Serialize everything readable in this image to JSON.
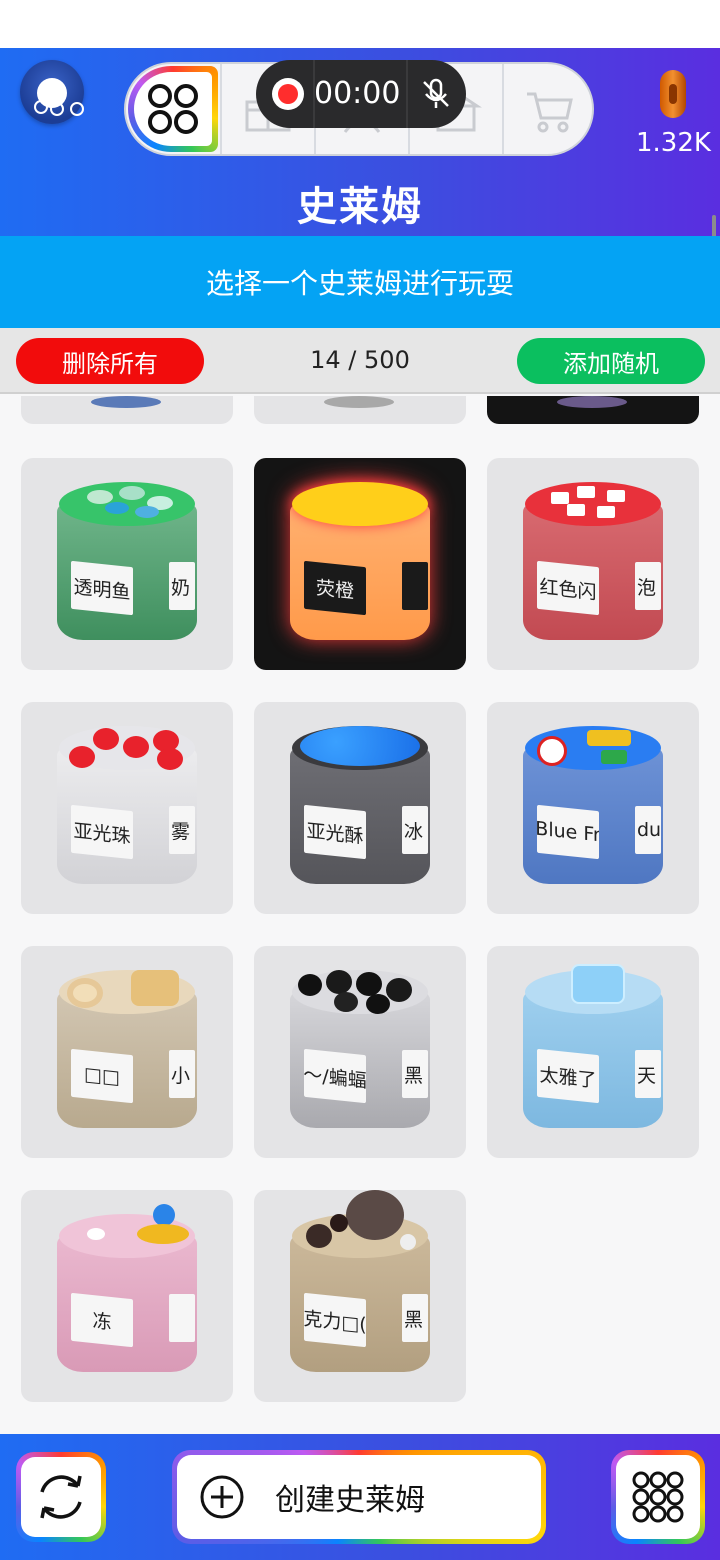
{
  "header": {
    "title": "史莱姆",
    "coins": "1.32K",
    "recorder": {
      "time": "00:00"
    }
  },
  "prompt": "选择一个史莱姆进行玩耍",
  "actions": {
    "delete_label": "删除所有",
    "count_text": "14 / 500",
    "add_label": "添加随机"
  },
  "slimes": [
    {
      "label": "透明鱼",
      "side": "奶"
    },
    {
      "label": "荧橙",
      "side": ""
    },
    {
      "label": "红色闪",
      "side": "泡"
    },
    {
      "label": "亚光珠",
      "side": "雾"
    },
    {
      "label": "亚光酥",
      "side": "冰"
    },
    {
      "label": "Blue Fr",
      "side": "du"
    },
    {
      "label": "□□",
      "side": "小"
    },
    {
      "label": "～/蝙蝠",
      "side": "黑"
    },
    {
      "label": "太雅了",
      "side": "天"
    },
    {
      "label": "冻",
      "side": ""
    },
    {
      "label": "克力□(",
      "side": "黑"
    }
  ],
  "footer": {
    "create_label": "创建史莱姆"
  },
  "icons": {
    "toolbar": [
      "grid-four-icon",
      "gift-icon",
      "person-icon",
      "store-icon",
      "cart-icon"
    ],
    "recorder": [
      "record-icon",
      "mic-off-icon"
    ],
    "footer": [
      "refresh-icon",
      "plus-circle-icon",
      "grid-nine-icon"
    ]
  }
}
